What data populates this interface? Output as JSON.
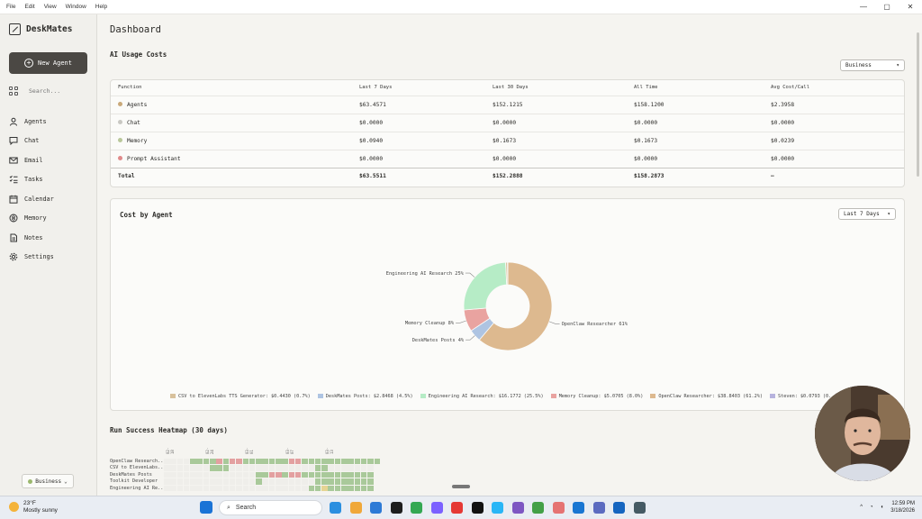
{
  "menu": [
    "File",
    "Edit",
    "View",
    "Window",
    "Help"
  ],
  "window_controls": [
    "—",
    "▢",
    "✕"
  ],
  "sidebar": {
    "app_name": "DeskMates",
    "new_agent_label": "New Agent",
    "search_placeholder": "Search...",
    "items": [
      {
        "label": "Agents",
        "icon": "agents-icon"
      },
      {
        "label": "Chat",
        "icon": "chat-icon"
      },
      {
        "label": "Email",
        "icon": "email-icon"
      },
      {
        "label": "Tasks",
        "icon": "tasks-icon"
      },
      {
        "label": "Calendar",
        "icon": "calendar-icon"
      },
      {
        "label": "Memory",
        "icon": "memory-icon"
      },
      {
        "label": "Notes",
        "icon": "notes-icon"
      },
      {
        "label": "Settings",
        "icon": "gear-icon"
      }
    ],
    "workspace": "Business"
  },
  "page_title": "Dashboard",
  "usage": {
    "title": "AI Usage Costs",
    "filter": "Business",
    "columns": [
      "Function",
      "Last 7 Days",
      "Last 30 Days",
      "All Time",
      "Avg Cost/Call"
    ],
    "rows": [
      {
        "name": "Agents",
        "color": "#c9a97a",
        "c": [
          "$63.4571",
          "$152.1215",
          "$158.1200",
          "$2.3958"
        ]
      },
      {
        "name": "Chat",
        "color": "#c9c8c3",
        "c": [
          "$0.0000",
          "$0.0000",
          "$0.0000",
          "$0.0000"
        ]
      },
      {
        "name": "Memory",
        "color": "#b9c79a",
        "c": [
          "$0.0940",
          "$0.1673",
          "$0.1673",
          "$0.0239"
        ]
      },
      {
        "name": "Prompt Assistant",
        "color": "#e08a8a",
        "c": [
          "$0.0000",
          "$0.0000",
          "$0.0000",
          "$0.0000"
        ]
      }
    ],
    "total": {
      "name": "Total",
      "c": [
        "$63.5511",
        "$152.2888",
        "$158.2873",
        "—"
      ]
    }
  },
  "cost_by_agent": {
    "title": "Cost by Agent",
    "filter": "Last 7 Days"
  },
  "chart_data": {
    "type": "pie",
    "donut": true,
    "slices": [
      {
        "label": "OpenClaw Researcher",
        "callout": "OpenClaw Researcher 61%",
        "value": 61.2,
        "color": "#ddb98f"
      },
      {
        "label": "DeskMates Posts",
        "callout": "DeskMates Posts 4%",
        "value": 4.5,
        "color": "#aec4e2"
      },
      {
        "label": "Memory Cleanup",
        "callout": "Memory Cleanup 8%",
        "value": 8.0,
        "color": "#e9a3a0"
      },
      {
        "label": "Engineering AI Research",
        "callout": "Engineering AI Research 25%",
        "value": 25.5,
        "color": "#b6ecc6"
      },
      {
        "label": "CSV to ElevenLabs TTS Generator",
        "callout": "",
        "value": 0.7,
        "color": "#d8c19c"
      },
      {
        "label": "Steven",
        "callout": "",
        "value": 0.1,
        "color": "#b7b3de"
      }
    ],
    "legend": [
      {
        "text": "CSV to ElevenLabs TTS Generator: $0.4430 (0.7%)",
        "color": "#d8c19c"
      },
      {
        "text": "DeskMates Posts: $2.8468 (4.5%)",
        "color": "#aec4e2"
      },
      {
        "text": "Engineering AI Research: $16.1772 (25.5%)",
        "color": "#b6ecc6"
      },
      {
        "text": "Memory Cleanup: $5.0705 (8.0%)",
        "color": "#e9a3a0"
      },
      {
        "text": "OpenClaw Researcher: $38.8403 (61.2%)",
        "color": "#ddb98f"
      },
      {
        "text": "Steven: $0.0793 (0.",
        "color": "#b7b3de"
      }
    ]
  },
  "heatmap": {
    "title": "Run Success Heatmap (30 days)",
    "dates": [
      "02-18",
      "02-24",
      "03-01",
      "03-07",
      "03-13"
    ],
    "rows": [
      {
        "label": "OpenClaw Research...",
        "cells": "0000ggggrgrrgggggggrrgggggggggggg"
      },
      {
        "label": "CSV to ElevenLabs...",
        "cells": "0000000ggg0000000000000gg0000000"
      },
      {
        "label": "DeskMates Posts",
        "cells": "00000000000000ggrrgrrggggggggggg"
      },
      {
        "label": "Toolkit Developer",
        "cells": "00000000000000g00000000ggggggggg"
      },
      {
        "label": "Engineering AI Re...",
        "cells": "0000000000000000000000ggyggggggg"
      }
    ]
  },
  "taskbar": {
    "temp": "23°F",
    "weather": "Mostly sunny",
    "search": "Search",
    "time": "12:59 PM",
    "date": "3/18/2026"
  }
}
